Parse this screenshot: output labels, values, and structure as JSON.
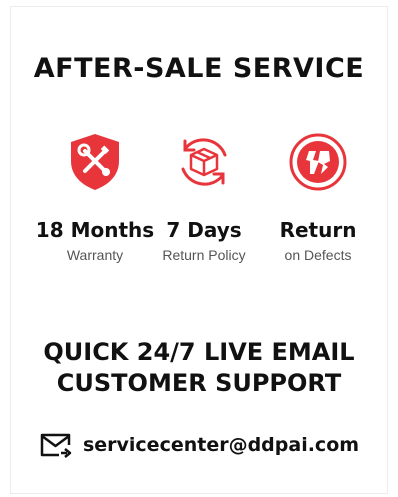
{
  "heading": "AFTER-SALE SERVICE",
  "features": [
    {
      "icon": "shield-tools-icon",
      "title": "18 Months",
      "subtitle": "Warranty"
    },
    {
      "icon": "package-return-icon",
      "title": "7 Days",
      "subtitle": "Return Policy"
    },
    {
      "icon": "broken-badge-icon",
      "title": "Return",
      "subtitle": "on Defects"
    }
  ],
  "support": {
    "line1": "QUICK 24/7 LIVE EMAIL",
    "line2": "CUSTOMER SUPPORT"
  },
  "email": {
    "icon": "mail-forward-icon",
    "address": "servicecenter@ddpai.com"
  },
  "colors": {
    "accent": "#e8353b",
    "text": "#111111",
    "subtext": "#555555"
  }
}
